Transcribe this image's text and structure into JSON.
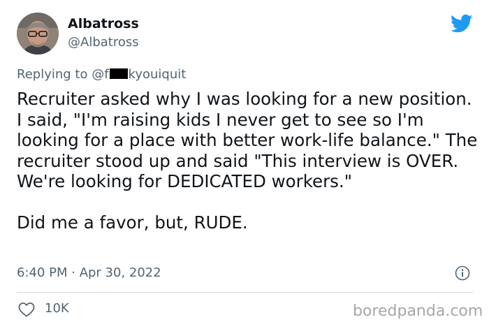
{
  "author": {
    "display_name": "Albatross",
    "handle": "@Albatross"
  },
  "reply": {
    "prefix": "Replying to ",
    "handle_start": "@f",
    "handle_end": "kyouiquit"
  },
  "tweet": {
    "paragraph_1": "Recruiter asked why I was looking for a new position. I said, \"I'm raising kids I never get to see so I'm looking for a place with better work-life balance.\" The recruiter stood up and said \"This interview is OVER. We're looking for DEDICATED workers.\"",
    "paragraph_2": "Did me a favor, but, RUDE."
  },
  "meta": {
    "time": "6:40 PM · Apr 30, 2022"
  },
  "actions": {
    "likes": "10K"
  },
  "watermark": "boredpanda.com",
  "colors": {
    "brand": "#1d9bf0",
    "text": "#0f1419",
    "secondary": "#536471",
    "divider": "#cfd9de"
  },
  "icons": [
    "twitter-bird-icon",
    "info-icon",
    "heart-icon"
  ]
}
